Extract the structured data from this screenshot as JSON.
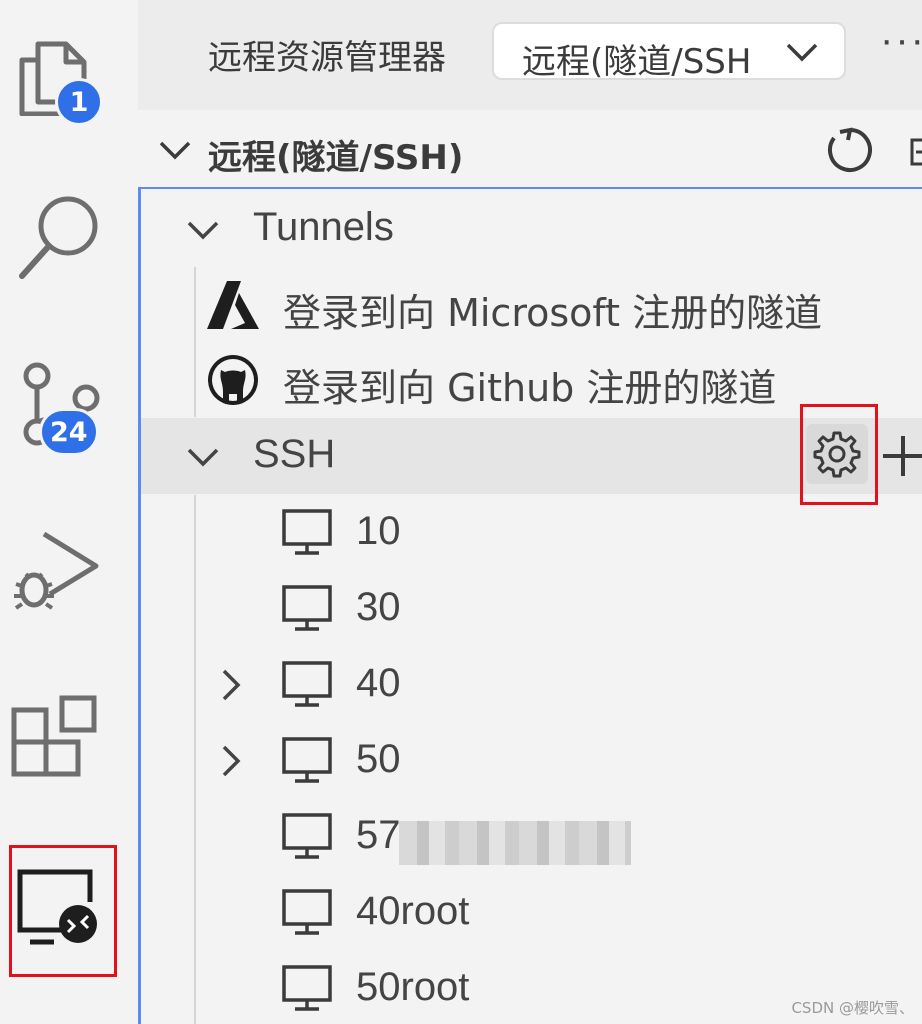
{
  "activity_bar": {
    "explorer_badge": "1",
    "source_control_badge": "24",
    "items": [
      {
        "name": "explorer",
        "icon": "files-icon"
      },
      {
        "name": "search",
        "icon": "search-icon"
      },
      {
        "name": "source-control",
        "icon": "source-control-icon"
      },
      {
        "name": "run-debug",
        "icon": "run-debug-icon"
      },
      {
        "name": "extensions",
        "icon": "extensions-icon"
      },
      {
        "name": "remote-explorer",
        "icon": "remote-explorer-icon",
        "highlighted": true
      }
    ]
  },
  "panel": {
    "title": "远程资源管理器",
    "select_value": "远程(隧道/SSH",
    "more_label": "···",
    "section_title": "远程(隧道/SSH)",
    "tunnels": {
      "label": "Tunnels",
      "items": [
        {
          "label": "登录到向 Microsoft 注册的隧道",
          "icon": "azure-icon"
        },
        {
          "label": "登录到向 Github 注册的隧道",
          "icon": "github-icon"
        }
      ]
    },
    "ssh": {
      "label": "SSH",
      "hosts": [
        {
          "label": "10",
          "expandable": false
        },
        {
          "label": "30",
          "expandable": false
        },
        {
          "label": "40",
          "expandable": true
        },
        {
          "label": "50",
          "expandable": true
        },
        {
          "label": "57",
          "expandable": false,
          "partially_obscured": true
        },
        {
          "label": "40root",
          "expandable": false
        },
        {
          "label": "50root",
          "expandable": false
        }
      ]
    }
  },
  "colors": {
    "accent_blue": "#2f6fe8",
    "focus_border": "#5b8def",
    "highlight_red": "#e3111b"
  },
  "watermark": "CSDN @樱吹雪、"
}
